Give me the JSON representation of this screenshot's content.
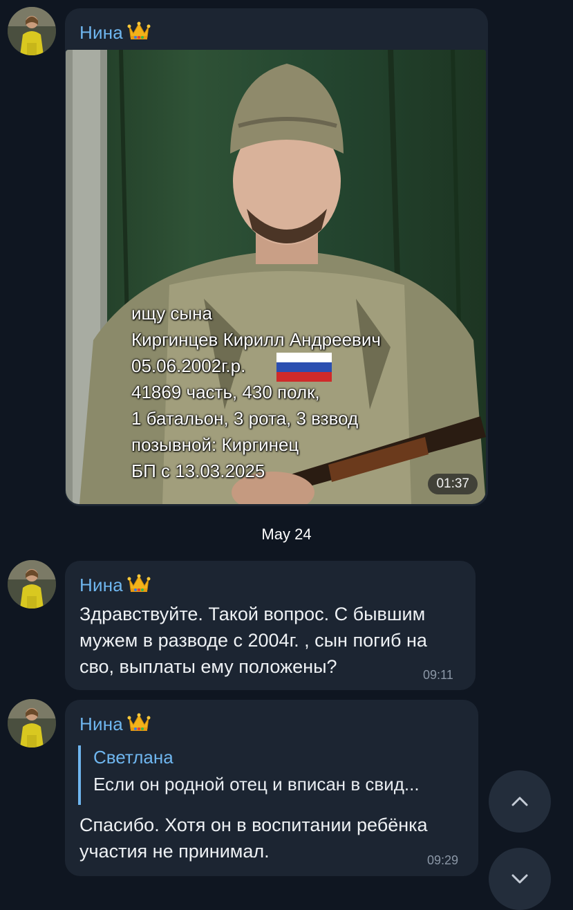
{
  "messages": [
    {
      "sender": "Нина",
      "type": "video",
      "overlay_lines": [
        "ищу сына",
        "Киргинцев Кирилл Андреевич",
        "05.06.2002г.р.",
        "41869 часть, 430 полк,",
        "1 батальон, 3 рота, 3 взвод",
        "позывной: Киргинец",
        "БП с 13.03.2025"
      ],
      "duration": "01:37"
    },
    {
      "sender": "Нина",
      "type": "text",
      "text": "Здравствуйте. Такой вопрос. С бывшим\nмужем в разводе с 2004г. , сын погиб на\nсво, выплаты ему положены?",
      "time": "09:11"
    },
    {
      "sender": "Нина",
      "type": "reply",
      "quote_author": "Светлана",
      "quote_text": "Если он родной отец и вписан в свид...",
      "text": "Спасибо. Хотя он в воспитании ребёнка\nучастия не принимал.",
      "time": "09:29"
    }
  ],
  "date_separator": "May 24",
  "colors": {
    "background": "#0f1621",
    "bubble": "#1c2532",
    "accent": "#6fb6ef",
    "time": "#8b97a6"
  },
  "icons": [
    "crown-icon",
    "chevron-up-icon",
    "chevron-down-icon"
  ]
}
